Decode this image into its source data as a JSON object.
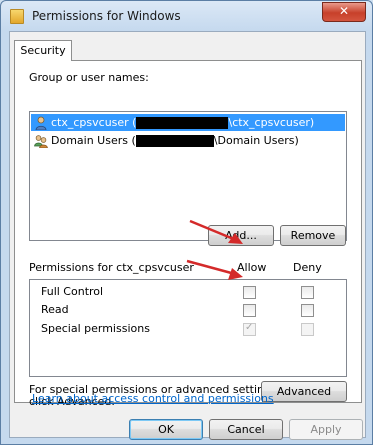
{
  "window": {
    "title": "Permissions for Windows",
    "close_label": "✕"
  },
  "tabs": [
    {
      "label": "Security"
    }
  ],
  "group_section": {
    "label": "Group or user names:",
    "users": [
      {
        "prefix": "ctx_cpsvcuser (",
        "suffix": "\\ctx_cpsvcuser)",
        "icon": "user-icon",
        "selected": true
      },
      {
        "prefix": "Domain Users (",
        "suffix": "\\Domain Users)",
        "icon": "group-icon",
        "selected": false
      }
    ],
    "add_label": "Add...",
    "remove_label": "Remove"
  },
  "permissions": {
    "label": "Permissions for ctx_cpsvcuser",
    "allow_header": "Allow",
    "deny_header": "Deny",
    "rows": [
      {
        "name": "Full Control",
        "allow": false,
        "deny": false
      },
      {
        "name": "Read",
        "allow": false,
        "deny": false
      },
      {
        "name": "Special permissions",
        "allow": true,
        "deny": false
      }
    ]
  },
  "advanced": {
    "text_line1": "For special permissions or advanced settings,",
    "text_line2": "click Advanced.",
    "button_label": "Advanced"
  },
  "help_link": "Learn about access control and permissions",
  "footer": {
    "ok_label": "OK",
    "cancel_label": "Cancel",
    "apply_label": "Apply"
  },
  "colors": {
    "selection": "#3399ff",
    "annotation_arrow": "#d42a2a",
    "link": "#0066cc"
  }
}
